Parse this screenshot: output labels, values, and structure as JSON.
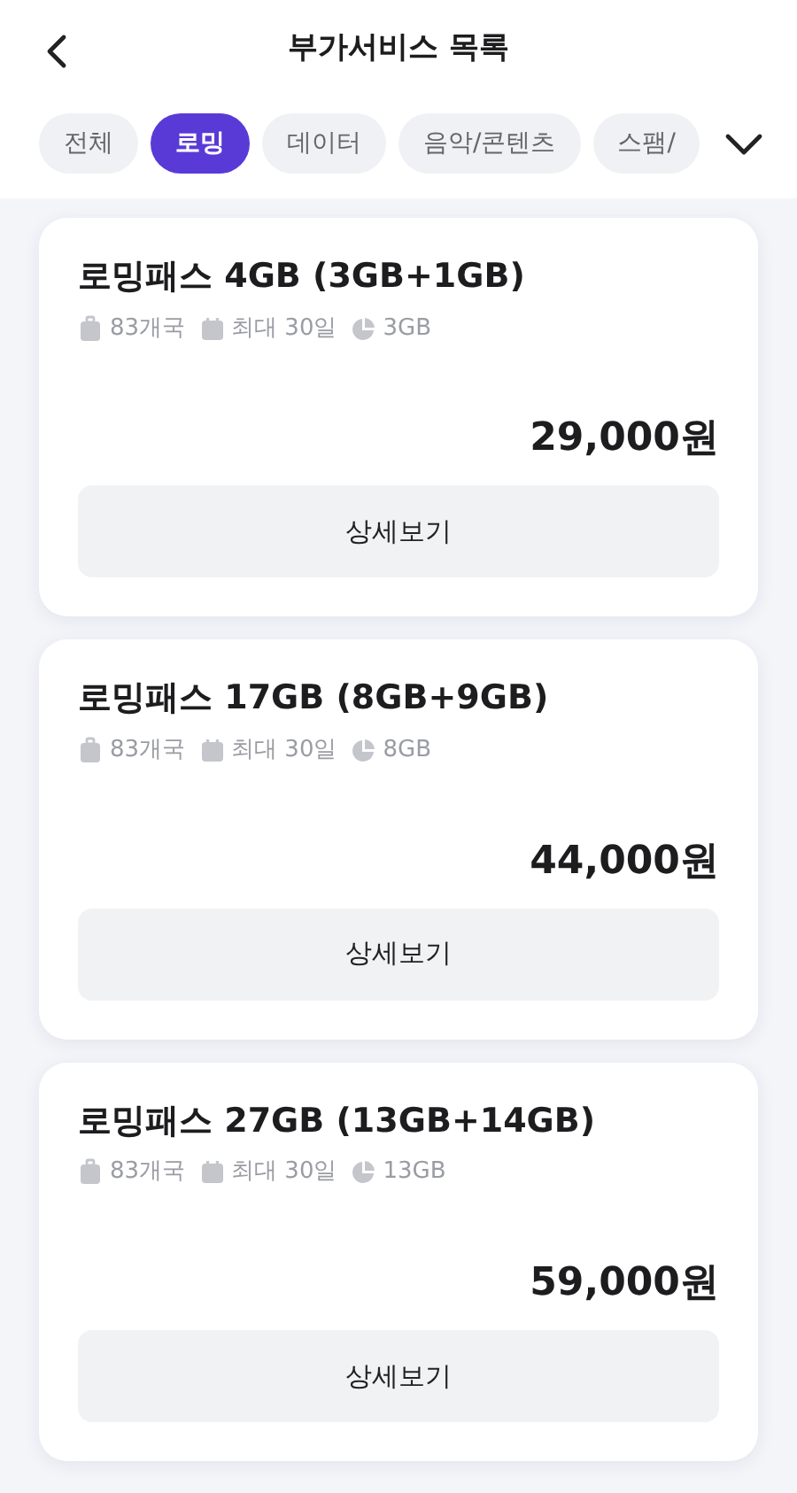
{
  "header": {
    "title": "부가서비스 목록"
  },
  "tabs": [
    {
      "label": "전체",
      "selected": false
    },
    {
      "label": "로밍",
      "selected": true
    },
    {
      "label": "데이터",
      "selected": false
    },
    {
      "label": "음악/콘텐츠",
      "selected": false
    },
    {
      "label": "스팸/",
      "selected": false
    }
  ],
  "products": [
    {
      "title": "로밍패스 4GB (3GB+1GB)",
      "countries": "83개국",
      "period": "최대 30일",
      "data": "3GB",
      "price": "29,000원",
      "button": "상세보기"
    },
    {
      "title": "로밍패스 17GB (8GB+9GB)",
      "countries": "83개국",
      "period": "최대 30일",
      "data": "8GB",
      "price": "44,000원",
      "button": "상세보기"
    },
    {
      "title": "로밍패스 27GB (13GB+14GB)",
      "countries": "83개국",
      "period": "최대 30일",
      "data": "13GB",
      "price": "59,000원",
      "button": "상세보기"
    }
  ]
}
